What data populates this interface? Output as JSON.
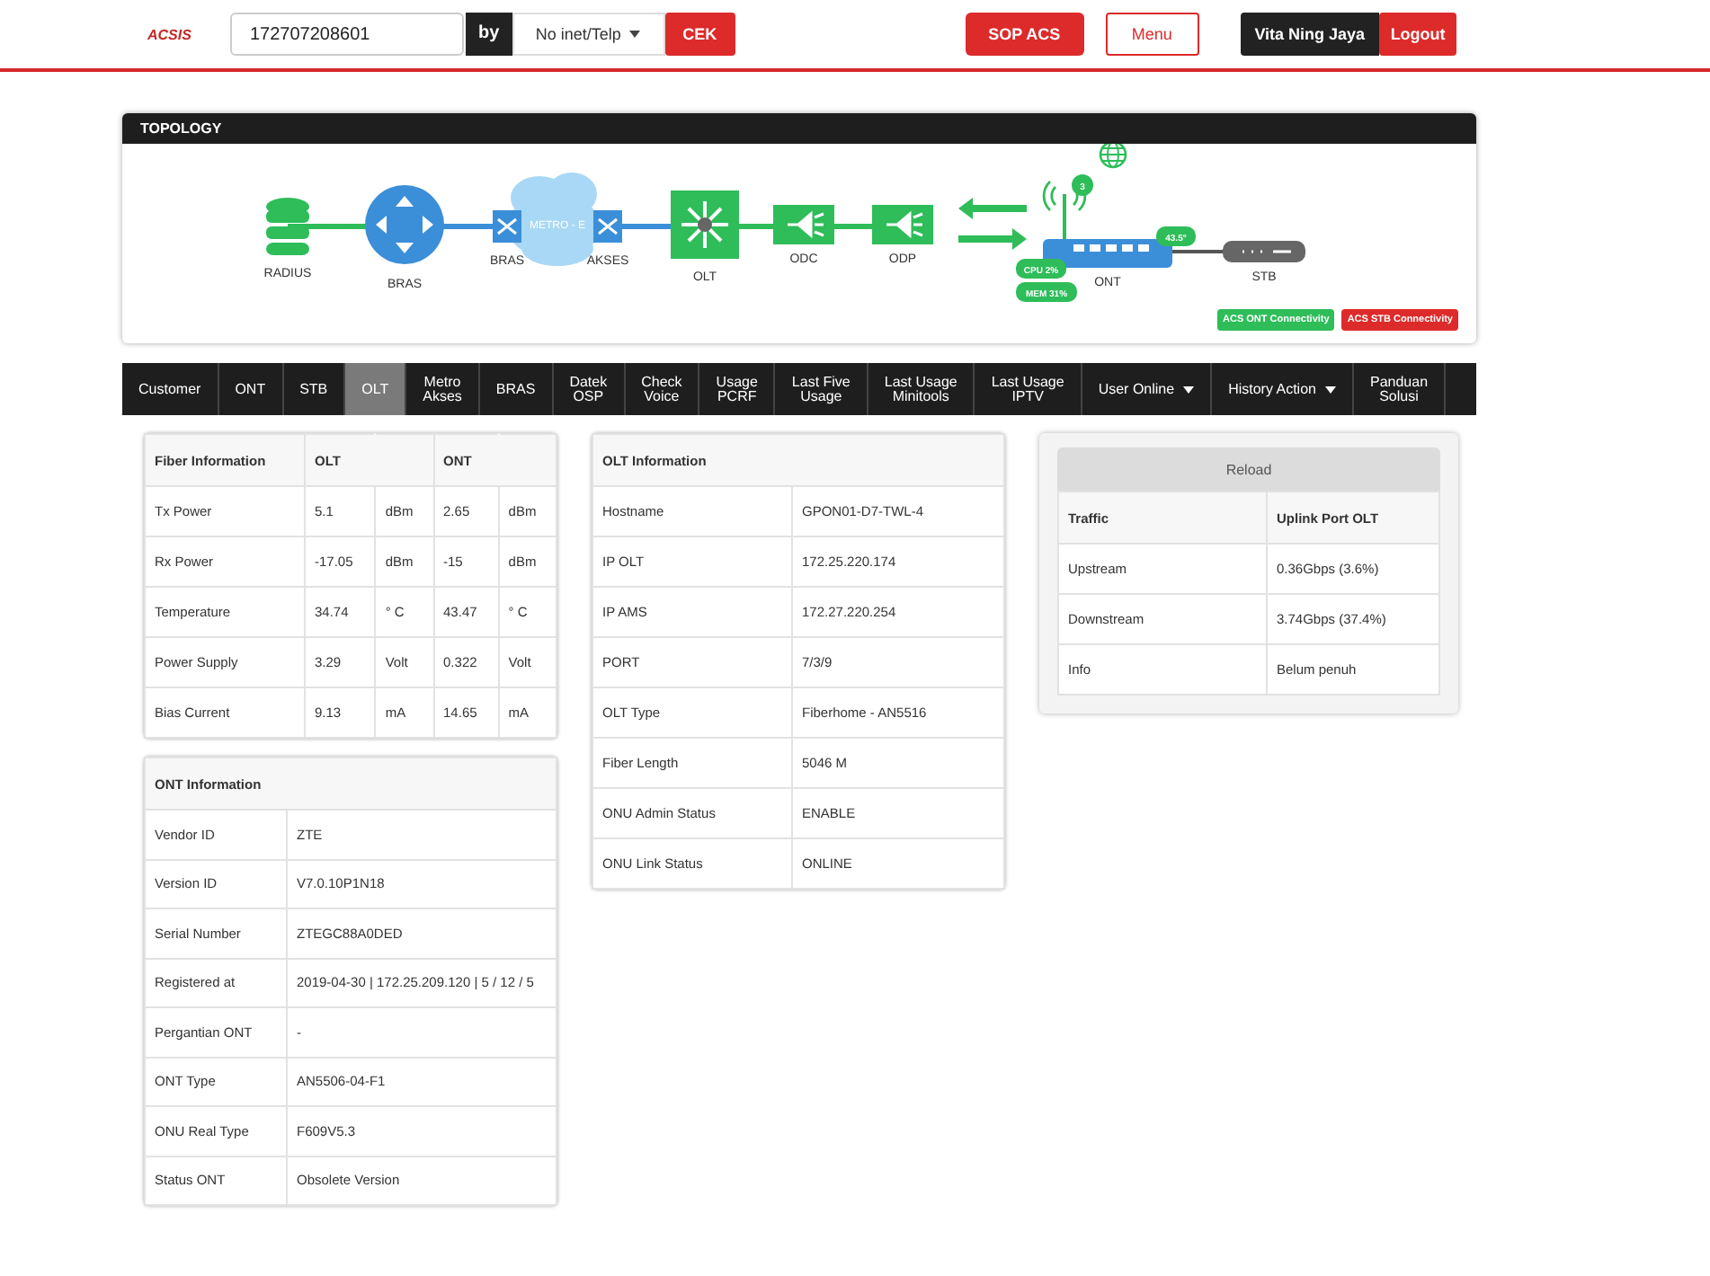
{
  "header": {
    "logo": "ACSIS",
    "search": {
      "value": "172707208601"
    },
    "by": "by",
    "select": "No inet/Telp",
    "check_button": "CEK",
    "sop_button": "SOP ACS",
    "menu_button": "Menu",
    "user": "Vita Ning Jaya",
    "logout": "Logout"
  },
  "topology": {
    "title": "TOPOLOGY",
    "cloud_label": "METRO - E",
    "nodes": [
      {
        "kind": "database",
        "label": "RADIUS"
      },
      {
        "kind": "router",
        "label": "BRAS"
      },
      {
        "kind": "switch",
        "label": "BRAS"
      },
      {
        "kind": "switch",
        "label": "AKSES"
      },
      {
        "kind": "olt",
        "label": "OLT"
      },
      {
        "kind": "splitter",
        "label": "ODC"
      },
      {
        "kind": "splitter",
        "label": "ODP"
      },
      {
        "kind": "ont",
        "label": "ONT"
      },
      {
        "kind": "stb",
        "label": "STB"
      }
    ],
    "ont_badges": {
      "wifi_clients": "3",
      "temperature": "43.5°",
      "cpu": "CPU 2%",
      "memory": "MEM 31%"
    },
    "legend": [
      {
        "label": "ACS ONT Connectivity",
        "color": "#2ebd59"
      },
      {
        "label": "ACS STB Connectivity",
        "color": "#dd2a2a"
      }
    ]
  },
  "tabs": [
    {
      "label": "Customer",
      "selected": false,
      "dropdown": false
    },
    {
      "label": "ONT",
      "selected": false,
      "dropdown": false
    },
    {
      "label": "STB",
      "selected": false,
      "dropdown": false
    },
    {
      "label": "OLT",
      "selected": true,
      "dropdown": false
    },
    {
      "label": "Metro\nAkses",
      "selected": false,
      "dropdown": false
    },
    {
      "label": "BRAS",
      "selected": false,
      "dropdown": false
    },
    {
      "label": "Datek\nOSP",
      "selected": false,
      "dropdown": false
    },
    {
      "label": "Check\nVoice",
      "selected": false,
      "dropdown": false
    },
    {
      "label": "Usage\nPCRF",
      "selected": false,
      "dropdown": false
    },
    {
      "label": "Last Five\nUsage",
      "selected": false,
      "dropdown": false
    },
    {
      "label": "Last Usage\nMinitools",
      "selected": false,
      "dropdown": false
    },
    {
      "label": "Last Usage\nIPTV",
      "selected": false,
      "dropdown": false
    },
    {
      "label": "User Online",
      "selected": false,
      "dropdown": true
    },
    {
      "label": "History Action",
      "selected": false,
      "dropdown": true
    },
    {
      "label": "Panduan\nSolusi",
      "selected": false,
      "dropdown": false
    }
  ],
  "fiber": {
    "columns": [
      "Fiber Information",
      "OLT",
      "",
      "ONT",
      ""
    ],
    "rows": [
      [
        "Tx Power",
        "5.1",
        "dBm",
        "2.65",
        "dBm"
      ],
      [
        "Rx Power",
        "-17.05",
        "dBm",
        "-15",
        "dBm"
      ],
      [
        "Temperature",
        "34.74",
        "° C",
        "43.47",
        "° C"
      ],
      [
        "Power Supply",
        "3.29",
        "Volt",
        "0.322",
        "Volt"
      ],
      [
        "Bias Current",
        "9.13",
        "mA",
        "14.65",
        "mA"
      ]
    ]
  },
  "ont_info": {
    "title": "ONT Information",
    "rows": [
      [
        "Vendor ID",
        "ZTE"
      ],
      [
        "Version ID",
        "V7.0.10P1N18"
      ],
      [
        "Serial Number",
        "ZTEGC88A0DED"
      ],
      [
        "Registered at",
        "2019-04-30 | 172.25.209.120 | 5 / 12 / 5"
      ],
      [
        "Pergantian ONT",
        "-"
      ],
      [
        "ONT Type",
        "AN5506-04-F1"
      ],
      [
        "ONU Real Type",
        "F609V5.3"
      ],
      [
        "Status ONT",
        "Obsolete Version"
      ]
    ]
  },
  "olt_info": {
    "title": "OLT Information",
    "rows": [
      [
        "Hostname",
        "GPON01-D7-TWL-4"
      ],
      [
        "IP OLT",
        "172.25.220.174"
      ],
      [
        "IP AMS",
        "172.27.220.254"
      ],
      [
        "PORT",
        "7/3/9"
      ],
      [
        "OLT Type",
        "Fiberhome - AN5516"
      ],
      [
        "Fiber Length",
        "5046 M"
      ],
      [
        "ONU Admin Status",
        "ENABLE"
      ],
      [
        "ONU Link Status",
        "ONLINE"
      ]
    ]
  },
  "traffic": {
    "reload": "Reload",
    "columns": [
      "Traffic",
      "Uplink Port OLT"
    ],
    "rows": [
      [
        "Upstream",
        "0.36Gbps (3.6%)"
      ],
      [
        "Downstream",
        "3.74Gbps (37.4%)"
      ],
      [
        "Info",
        "Belum penuh"
      ]
    ]
  }
}
